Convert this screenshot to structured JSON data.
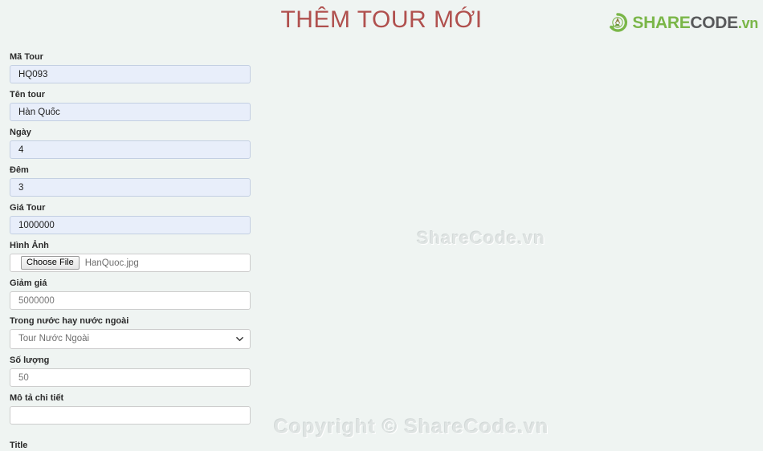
{
  "header": {
    "title": "THÊM TOUR MỚI",
    "logo": {
      "icon_name": "sharecode-recycle-icon",
      "share": "SHARE",
      "code": "CODE",
      "tld": ".vn",
      "green": "#7ab648",
      "grey": "#58595b"
    },
    "title_color": "#b0504e"
  },
  "watermarks": {
    "center": "ShareCode.vn",
    "bottom": "Copyright © ShareCode.vn"
  },
  "form": {
    "fields": [
      {
        "label": "Mã Tour",
        "value": "HQ093",
        "state": "autofilled"
      },
      {
        "label": "Tên tour",
        "value": "Hàn Quốc",
        "state": "autofilled"
      },
      {
        "label": "Ngày",
        "value": "4",
        "state": "autofilled"
      },
      {
        "label": "Đêm",
        "value": "3",
        "state": "autofilled"
      },
      {
        "label": "Giá Tour",
        "value": "1000000",
        "state": "autofilled"
      }
    ],
    "file_field": {
      "label": "Hình Ảnh",
      "button_label": "Choose File",
      "file_name": "HanQuoc.jpg"
    },
    "discount_field": {
      "label": "Giảm giá",
      "value": "5000000"
    },
    "select_field": {
      "label": "Trong nước hay nước ngoài",
      "selected": "Tour Nước Ngoài",
      "chevron_icon": "chevron-down-icon"
    },
    "quantity_field": {
      "label": "Số lượng",
      "value": "50"
    },
    "description_field": {
      "label": "Mô tả chi tiết",
      "value": ""
    },
    "clipped_field": {
      "label": "Title"
    }
  },
  "page": {
    "background": "#eff4f2"
  }
}
